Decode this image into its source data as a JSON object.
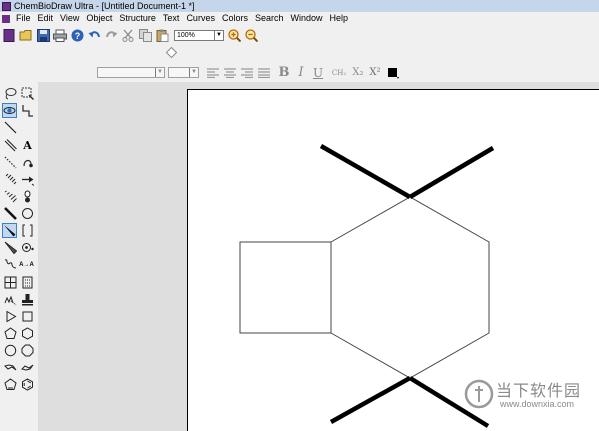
{
  "window": {
    "title": "ChemBioDraw Ultra - [Untitled Document-1 *]"
  },
  "menu": [
    "File",
    "Edit",
    "View",
    "Object",
    "Structure",
    "Text",
    "Curves",
    "Colors",
    "Search",
    "Window",
    "Help"
  ],
  "toolbar": {
    "zoom_value": "100%"
  },
  "format_toolbar": {
    "bold": "B",
    "italic": "I",
    "underline": "U",
    "formula": "CH₂",
    "subscript": "X₂",
    "superscript": "X²",
    "text_color": "#000000"
  },
  "palette_labels": {
    "text_tool": "A",
    "atom_map": "A→A"
  },
  "watermark": {
    "title": "当下软件园",
    "url": "www.downxia.com"
  },
  "colors": {
    "active_tool": "#bfd9f4",
    "workspace": "#dedede",
    "app_icon": "#6a2f86"
  }
}
